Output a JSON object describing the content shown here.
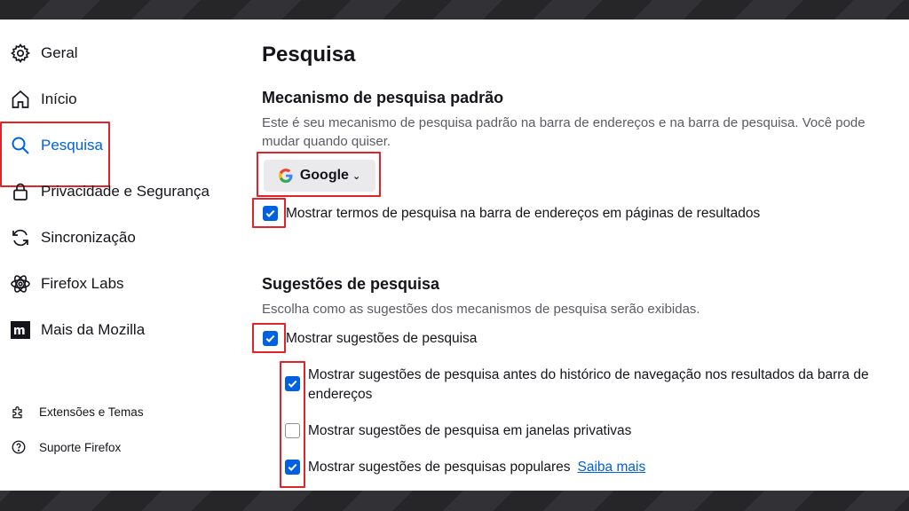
{
  "sidebar": {
    "items": [
      {
        "label": "Geral",
        "icon": "gear-icon"
      },
      {
        "label": "Início",
        "icon": "home-icon"
      },
      {
        "label": "Pesquisa",
        "icon": "search-icon",
        "active": true
      },
      {
        "label": "Privacidade e Segurança",
        "icon": "lock-icon"
      },
      {
        "label": "Sincronização",
        "icon": "sync-icon"
      },
      {
        "label": "Firefox Labs",
        "icon": "atom-icon"
      },
      {
        "label": "Mais da Mozilla",
        "icon": "mozilla-m-icon"
      }
    ],
    "footer": [
      {
        "label": "Extensões e Temas",
        "icon": "puzzle-icon"
      },
      {
        "label": "Suporte Firefox",
        "icon": "help-icon"
      }
    ]
  },
  "main": {
    "title": "Pesquisa",
    "default_engine": {
      "heading": "Mecanismo de pesquisa padrão",
      "description": "Este é seu mecanismo de pesquisa padrão na barra de endereços e na barra de pesquisa. Você pode mudar quando quiser.",
      "selected": "Google",
      "show_terms_label": "Mostrar termos de pesquisa na barra de endereços em páginas de resultados",
      "show_terms_checked": true
    },
    "suggestions": {
      "heading": "Sugestões de pesquisa",
      "description": "Escolha como as sugestões dos mecanismos de pesquisa serão exibidas.",
      "show_label": "Mostrar sugestões de pesquisa",
      "show_checked": true,
      "before_history_label": "Mostrar sugestões de pesquisa antes do histórico de navegação nos resultados da barra de endereços",
      "before_history_checked": true,
      "private_label": "Mostrar sugestões de pesquisa em janelas privativas",
      "private_checked": false,
      "popular_label": "Mostrar sugestões de pesquisas populares",
      "popular_checked": true,
      "learn_more": "Saiba mais"
    }
  },
  "colors": {
    "accent": "#0061e0",
    "highlight": "#e0242a"
  }
}
